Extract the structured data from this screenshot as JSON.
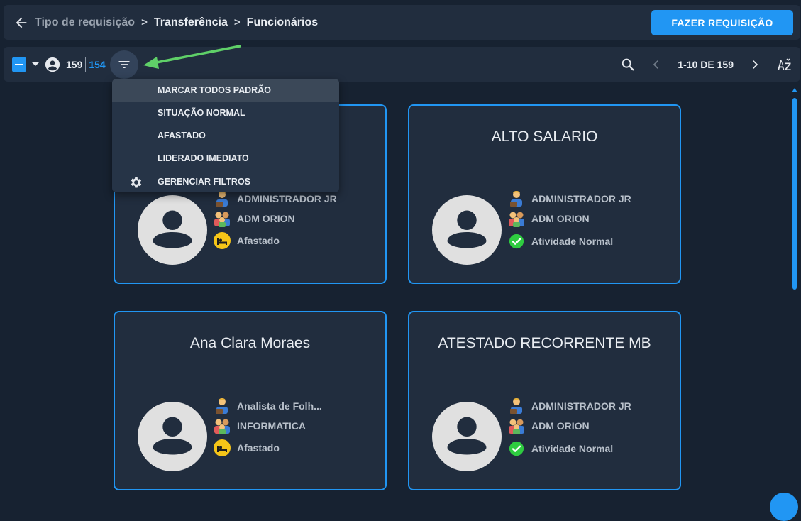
{
  "breadcrumb": {
    "items": [
      "Tipo de requisição",
      "Transferência",
      "Funcionários"
    ],
    "separator": ">"
  },
  "header": {
    "request_button": "FAZER REQUISIÇÃO"
  },
  "toolbar": {
    "count_total": "159",
    "count_selected": "154",
    "page_info": "1-10 DE 159",
    "sort_icon": "az-sort-icon",
    "accent": "#2196f3"
  },
  "filter_menu": {
    "items": [
      "MARCAR TODOS PADRÃO",
      "SITUAÇÃO NORMAL",
      "AFASTADO",
      "LIDERADO IMEDIATO"
    ],
    "manage": "GERENCIAR FILTROS"
  },
  "cards": [
    {
      "name": "",
      "role": "ADMINISTRADOR JR",
      "department": "ADM ORION",
      "status": "Afastado",
      "status_icon": "bed-icon"
    },
    {
      "name": "ALTO SALARIO",
      "role": "ADMINISTRADOR JR",
      "department": "ADM ORION",
      "status": "Atividade Normal",
      "status_icon": "check-circle-icon"
    },
    {
      "name": "Ana Clara Moraes",
      "role": "Analista de Folh...",
      "department": "INFORMATICA",
      "status": "Afastado",
      "status_icon": "bed-icon"
    },
    {
      "name": "ATESTADO RECORRENTE MB",
      "role": "ADMINISTRADOR JR",
      "department": "ADM ORION",
      "status": "Atividade Normal",
      "status_icon": "check-circle-icon"
    }
  ],
  "colors": {
    "background": "#172231",
    "panel": "#212d3e",
    "accent": "#2196f3",
    "annotation_arrow": "#5fd068",
    "warning": "#f5c518",
    "success": "#2ecc40"
  }
}
